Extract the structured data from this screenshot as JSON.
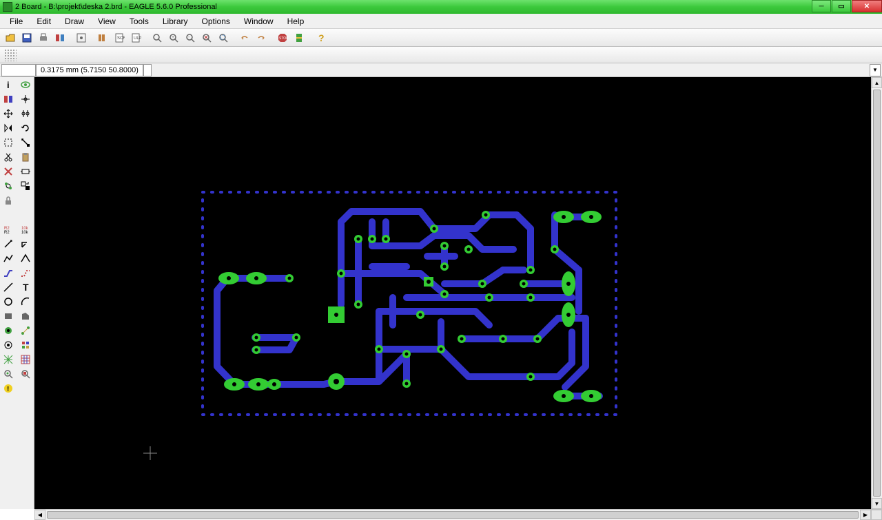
{
  "window": {
    "title": "2 Board - B:\\projekt\\deska 2.brd - EAGLE 5.6.0 Professional"
  },
  "menu": {
    "file": "File",
    "edit": "Edit",
    "draw": "Draw",
    "view": "View",
    "tools": "Tools",
    "library": "Library",
    "options": "Options",
    "window": "Window",
    "help": "Help"
  },
  "coords": {
    "text": "0.3175 mm (5.7150 50.8000)"
  }
}
